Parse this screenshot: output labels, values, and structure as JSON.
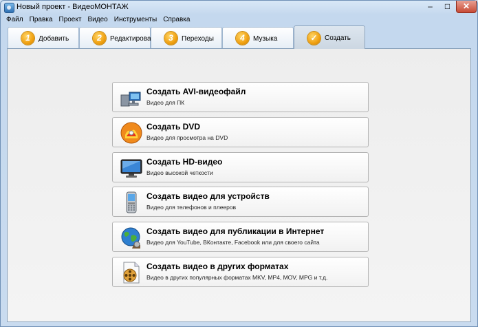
{
  "window": {
    "title": "Новый проект - ВидеоМОНТАЖ",
    "minimize": "–",
    "maximize": "□",
    "close": "✕"
  },
  "menu": [
    "Файл",
    "Правка",
    "Проект",
    "Видео",
    "Инструменты",
    "Справка"
  ],
  "tabs": [
    {
      "num": "1",
      "label": "Добавить"
    },
    {
      "num": "2",
      "label": "Редактировать"
    },
    {
      "num": "3",
      "label": "Переходы"
    },
    {
      "num": "4",
      "label": "Музыка"
    },
    {
      "num": "✓",
      "label": "Создать",
      "active": true
    }
  ],
  "options": [
    {
      "icon": "avi-file-icon",
      "title": "Создать AVI-видеофайл",
      "subtitle": "Видео для ПК"
    },
    {
      "icon": "dvd-disc-icon",
      "title": "Создать DVD",
      "subtitle": "Видео для просмотра на DVD"
    },
    {
      "icon": "hd-monitor-icon",
      "title": "Создать HD-видео",
      "subtitle": "Видео высокой четкости"
    },
    {
      "icon": "mobile-phone-icon",
      "title": "Создать видео для устройств",
      "subtitle": "Видео для телефонов и плееров"
    },
    {
      "icon": "globe-icon",
      "title": "Создать видео для публикации в Интернет",
      "subtitle": "Видео для YouTube, ВКонтакте, Facebook или для своего сайта"
    },
    {
      "icon": "film-reel-icon",
      "title": "Создать видео в других форматах",
      "subtitle": "Видео в других популярных форматах MKV, MP4, MOV, MPG и т.д."
    }
  ]
}
